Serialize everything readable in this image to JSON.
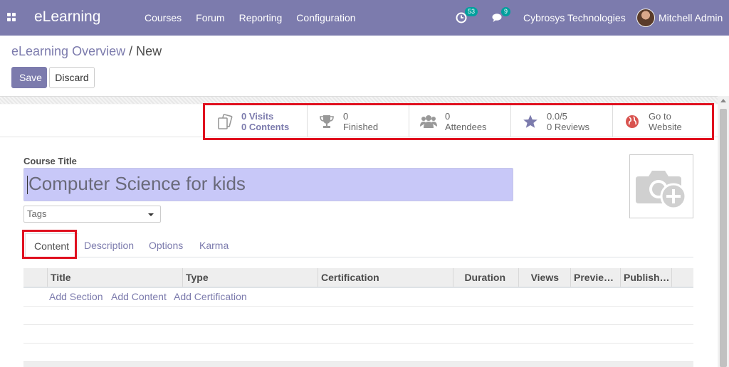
{
  "navbar": {
    "app_name": "eLearning",
    "menu": [
      "Courses",
      "Forum",
      "Reporting",
      "Configuration"
    ],
    "activity_count": "53",
    "message_count": "9",
    "company": "Cybrosys Technologies",
    "user": "Mitchell Admin"
  },
  "breadcrumb": {
    "parent": "eLearning Overview",
    "separator": " / ",
    "current": "New"
  },
  "buttons": {
    "save": "Save",
    "discard": "Discard"
  },
  "stats": [
    {
      "value": "0 Visits",
      "label": "0 Contents",
      "icon": "documents-icon"
    },
    {
      "value": "0",
      "label": "Finished",
      "icon": "trophy-icon"
    },
    {
      "value": "0",
      "label": "Attendees",
      "icon": "users-icon"
    },
    {
      "value": "0.0/5",
      "label": "0 Reviews",
      "icon": "star-icon"
    },
    {
      "value": "Go to",
      "label": "Website",
      "icon": "globe-icon"
    }
  ],
  "form": {
    "course_title_label": "Course Title",
    "course_title_value": "Computer Science for kids",
    "tags_placeholder": "Tags"
  },
  "tabs": [
    "Content",
    "Description",
    "Options",
    "Karma"
  ],
  "table": {
    "columns": [
      "Title",
      "Type",
      "Certification",
      "Duration",
      "Views",
      "Previe…",
      "Publish…"
    ],
    "add_links": [
      "Add Section",
      "Add Content",
      "Add Certification"
    ]
  },
  "colors": {
    "brand": "#7c7bad",
    "highlight": "#e0101f",
    "title_bg": "#c8c8f8"
  }
}
